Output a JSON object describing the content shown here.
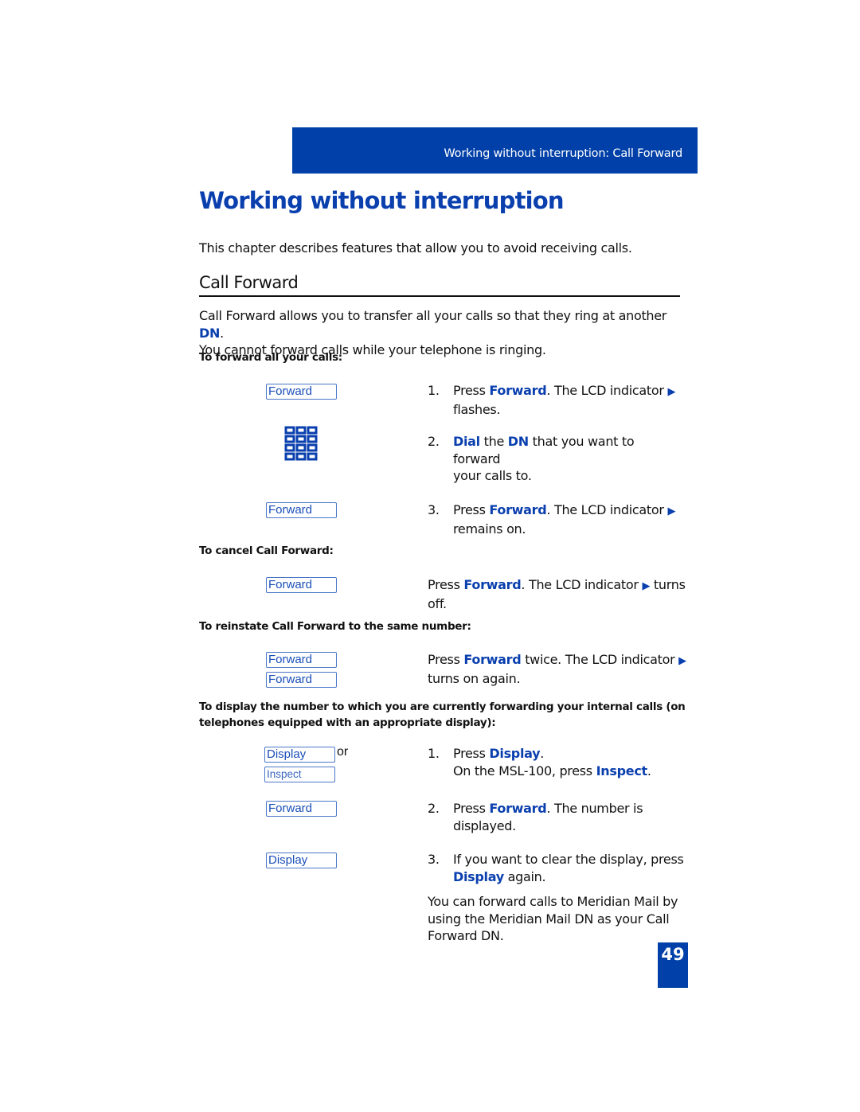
{
  "header": {
    "running_title": "Working without interruption: Call Forward"
  },
  "chapter": {
    "title": "Working without interruption",
    "intro": "This chapter describes features that allow you to avoid receiving calls."
  },
  "section": {
    "title": "Call Forward",
    "para_part1": "Call Forward allows you to transfer all your calls so that they ring at another ",
    "para_dn": "DN",
    "para_part2": ".",
    "para_line2": "You cannot forward calls while your telephone is ringing."
  },
  "forward_all": {
    "heading": "To forward all your calls:",
    "keys": [
      "Forward",
      "Forward"
    ],
    "keypad_icon": "dialpad-icon",
    "steps": [
      {
        "num": "1.",
        "pre": "Press ",
        "key": "Forward",
        "post": ". The LCD indicator ",
        "indicator": "▶",
        "line2": "flashes."
      },
      {
        "num": "2.",
        "key1": "Dial",
        "mid1": " the ",
        "key2": "DN",
        "mid2": " that you want to forward",
        "line2": "your calls to."
      },
      {
        "num": "3.",
        "pre": "Press ",
        "key": "Forward",
        "post": ". The LCD indicator ",
        "indicator": "▶",
        "line2": "remains on."
      }
    ]
  },
  "cancel": {
    "heading": "To cancel Call Forward:",
    "key": "Forward",
    "pre": "Press ",
    "blue": "Forward",
    "post": ". The LCD indicator ",
    "indicator": "▶",
    "tail": " turns",
    "line2": "off."
  },
  "reinstate": {
    "heading": "To reinstate Call Forward to the same number:",
    "keys": [
      "Forward",
      "Forward"
    ],
    "pre": "Press ",
    "blue": "Forward",
    "post": " twice. The LCD indicator ",
    "indicator": "▶",
    "line2": "turns on again."
  },
  "display": {
    "heading_line1": "To display the number to which you are currently forwarding your internal calls (on",
    "heading_line2": "telephones equipped with an appropriate display):",
    "keys": {
      "display": "Display",
      "or": "or",
      "inspect": "Inspect",
      "forward": "Forward",
      "display2": "Display"
    },
    "steps": [
      {
        "num": "1.",
        "pre": "Press ",
        "key": "Display",
        "post": ".",
        "line2_pre": "On the MSL-100, press ",
        "line2_key": "Inspect",
        "line2_post": "."
      },
      {
        "num": "2.",
        "pre": "Press ",
        "key": "Forward",
        "post": ". The number is",
        "line2": "displayed."
      },
      {
        "num": "3.",
        "line1": "If you want to clear the display, press",
        "line2_key": "Display",
        "line2_post": " again."
      }
    ],
    "note_line1": "You can forward calls to Meridian Mail by",
    "note_line2": "using the Meridian Mail DN as your Call",
    "note_line3": "Forward DN."
  },
  "page_number": "49",
  "colors": {
    "brand_blue": "#0040a8",
    "text_blue": "#0a3fae",
    "key_border": "#4a76c8"
  }
}
